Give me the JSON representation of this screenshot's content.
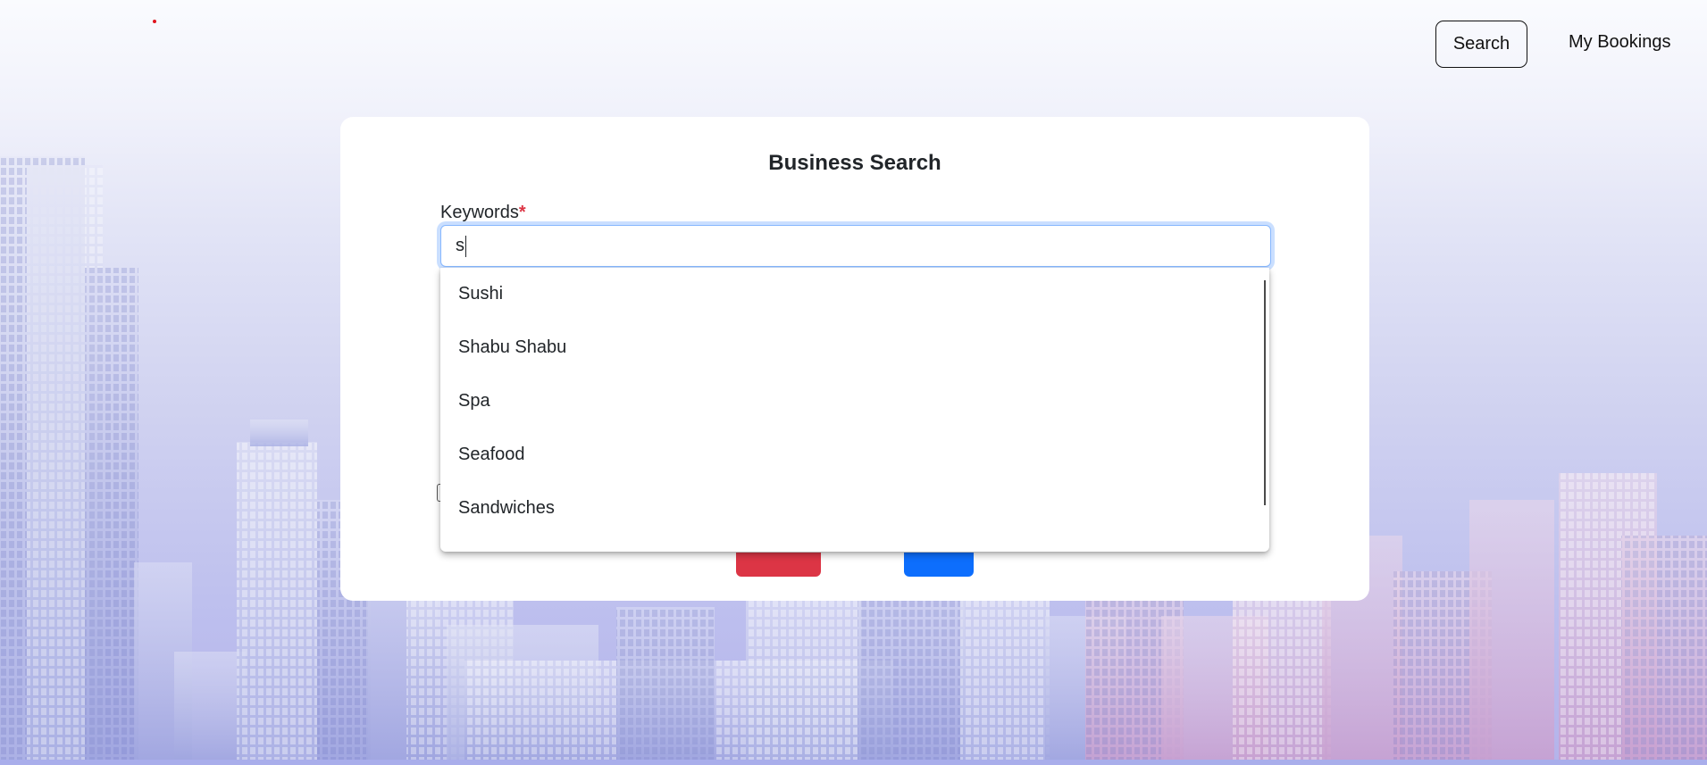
{
  "nav": {
    "search_label": "Search",
    "bookings_label": "My Bookings"
  },
  "form": {
    "title": "Business Search",
    "keywords_label": "Keywords",
    "required_mark": "*",
    "keywords_value": "s"
  },
  "autocomplete": {
    "items": [
      "Sushi",
      "Shabu Shabu",
      "Spa",
      "Seafood",
      "Sandwiches"
    ]
  },
  "colors": {
    "brand_dot": "#e0141e",
    "clear_button": "#dc3545",
    "submit_button": "#0d6efd",
    "focus_ring": "#86b7fe"
  }
}
